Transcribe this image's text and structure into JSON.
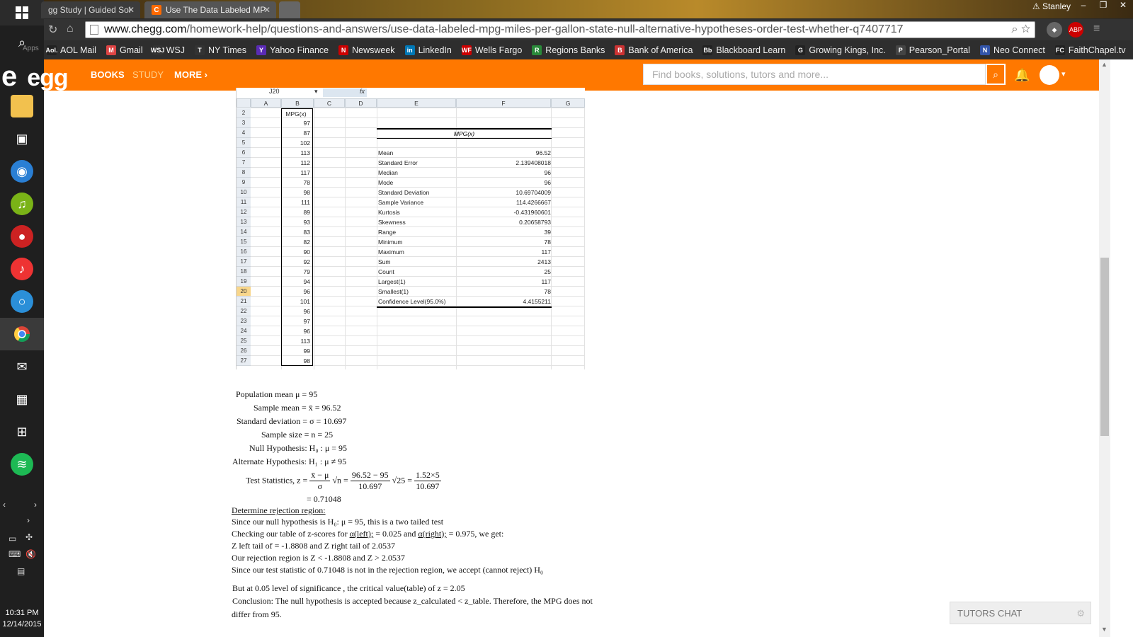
{
  "taskbar": {
    "clock_time": "10:31 PM",
    "clock_date": "12/14/2015"
  },
  "browser": {
    "tabs": [
      {
        "label": "gg Study | Guided Sol"
      },
      {
        "label": "Use The Data Labeled MP"
      }
    ],
    "profile_name": "Stanley",
    "url_domain": "www.chegg.com",
    "url_path": "/homework-help/questions-and-answers/use-data-labeled-mpg-miles-per-gallon-state-null-alternative-hypotheses-order-test-whether-q7407717",
    "apps_label": "Apps",
    "bookmarks": [
      {
        "label": "AOL Mail",
        "icon": "Aol."
      },
      {
        "label": "Gmail",
        "icon": "M"
      },
      {
        "label": "WSJ",
        "icon": "WSJ"
      },
      {
        "label": "NY Times",
        "icon": "T"
      },
      {
        "label": "Yahoo Finance",
        "icon": "Y"
      },
      {
        "label": "Newsweek",
        "icon": "N"
      },
      {
        "label": "LinkedIn",
        "icon": "in"
      },
      {
        "label": "Wells Fargo",
        "icon": "WF"
      },
      {
        "label": "Regions Banks",
        "icon": "R"
      },
      {
        "label": "Bank of America",
        "icon": "B"
      },
      {
        "label": "Blackboard Learn",
        "icon": "Bb"
      },
      {
        "label": "Growing Kings, Inc.",
        "icon": "G"
      },
      {
        "label": "Pearson_Portal",
        "icon": "P"
      },
      {
        "label": "Neo Connect",
        "icon": "N"
      },
      {
        "label": "FaithChapel.tv",
        "icon": "FC"
      }
    ]
  },
  "chegg": {
    "logo": "egg",
    "nav_books": "BOOKS",
    "nav_study": "STUDY",
    "nav_more": "MORE ›",
    "search_placeholder": "Find books, solutions, tutors and more..."
  },
  "sheet": {
    "name_box": "J20",
    "fx": "fx",
    "columns": [
      "A",
      "B",
      "C",
      "D",
      "E",
      "F",
      "G"
    ],
    "rows": [
      "2",
      "3",
      "4",
      "5",
      "6",
      "7",
      "8",
      "9",
      "10",
      "11",
      "12",
      "13",
      "14",
      "15",
      "16",
      "17",
      "18",
      "19",
      "20",
      "21",
      "22",
      "23",
      "24",
      "25",
      "26",
      "27"
    ],
    "mpg_header": "MPG(x)",
    "mpg_values": [
      "97",
      "87",
      "102",
      "113",
      "112",
      "117",
      "78",
      "98",
      "111",
      "89",
      "93",
      "83",
      "82",
      "90",
      "92",
      "79",
      "94",
      "96",
      "101",
      "96",
      "97",
      "96",
      "113",
      "99",
      "98"
    ],
    "stats_title": "MPG(x)",
    "stats": [
      {
        "label": "Mean",
        "value": "96.52"
      },
      {
        "label": "Standard Error",
        "value": "2.139408018"
      },
      {
        "label": "Median",
        "value": "96"
      },
      {
        "label": "Mode",
        "value": "96"
      },
      {
        "label": "Standard Deviation",
        "value": "10.69704009"
      },
      {
        "label": "Sample Variance",
        "value": "114.4266667"
      },
      {
        "label": "Kurtosis",
        "value": "-0.431960601"
      },
      {
        "label": "Skewness",
        "value": "0.20658793"
      },
      {
        "label": "Range",
        "value": "39"
      },
      {
        "label": "Minimum",
        "value": "78"
      },
      {
        "label": "Maximum",
        "value": "117"
      },
      {
        "label": "Sum",
        "value": "2413"
      },
      {
        "label": "Count",
        "value": "25"
      },
      {
        "label": "Largest(1)",
        "value": "117"
      },
      {
        "label": "Smallest(1)",
        "value": "78"
      },
      {
        "label": "Confidence Level(95.0%)",
        "value": "4.4155211"
      }
    ]
  },
  "solution": {
    "pop_mean": "Population mean μ = 95",
    "sample_mean": "Sample mean = x̄ = 96.52",
    "std_dev": "Standard deviation = σ = 10.697",
    "sample_size": "Sample size = n = 25",
    "null_h": "Null Hypothesis: H₀ : μ = 95",
    "alt_h": "Alternate Hypothesis: H₁ : μ ≠ 95",
    "test_stat_label": "Test Statistics, z =",
    "f1_num": "x̄ − μ",
    "f1_den": "σ",
    "sqrt_n": "√n =",
    "f2_num": "96.52 − 95",
    "f2_den": "10.697",
    "sqrt_25": "√25 =",
    "f3_num": "1.52×5",
    "f3_den": "10.697",
    "z_result": "= 0.71048",
    "reject_heading": "Determine rejection region:",
    "line1": "Since our null hypothesis is H₀:  μ = 95, this is a two tailed test",
    "line2_a": "Checking our table of z-scores for ",
    "line2_b": "α(left);",
    "line2_c": " = 0.025 and ",
    "line2_d": "α(right);",
    "line2_e": " = 0.975, we get:",
    "line3": "Z left tail of = -1.8808 and Z right tail of 2.0537",
    "line4": "Our rejection region is Z < -1.8808 and Z > 2.0537",
    "line5": "Since our test statistic of 0.71048 is not in the rejection region, we accept (cannot reject) H₀",
    "line6": "But at 0.05 level of significance , the critical value(table) of z = 2.05",
    "line7": "Conclusion: The null hypothesis is accepted because z_calculated < z_table. Therefore, the MPG does not",
    "line8": "differ from 95."
  },
  "tutors_chat": "TUTORS CHAT"
}
